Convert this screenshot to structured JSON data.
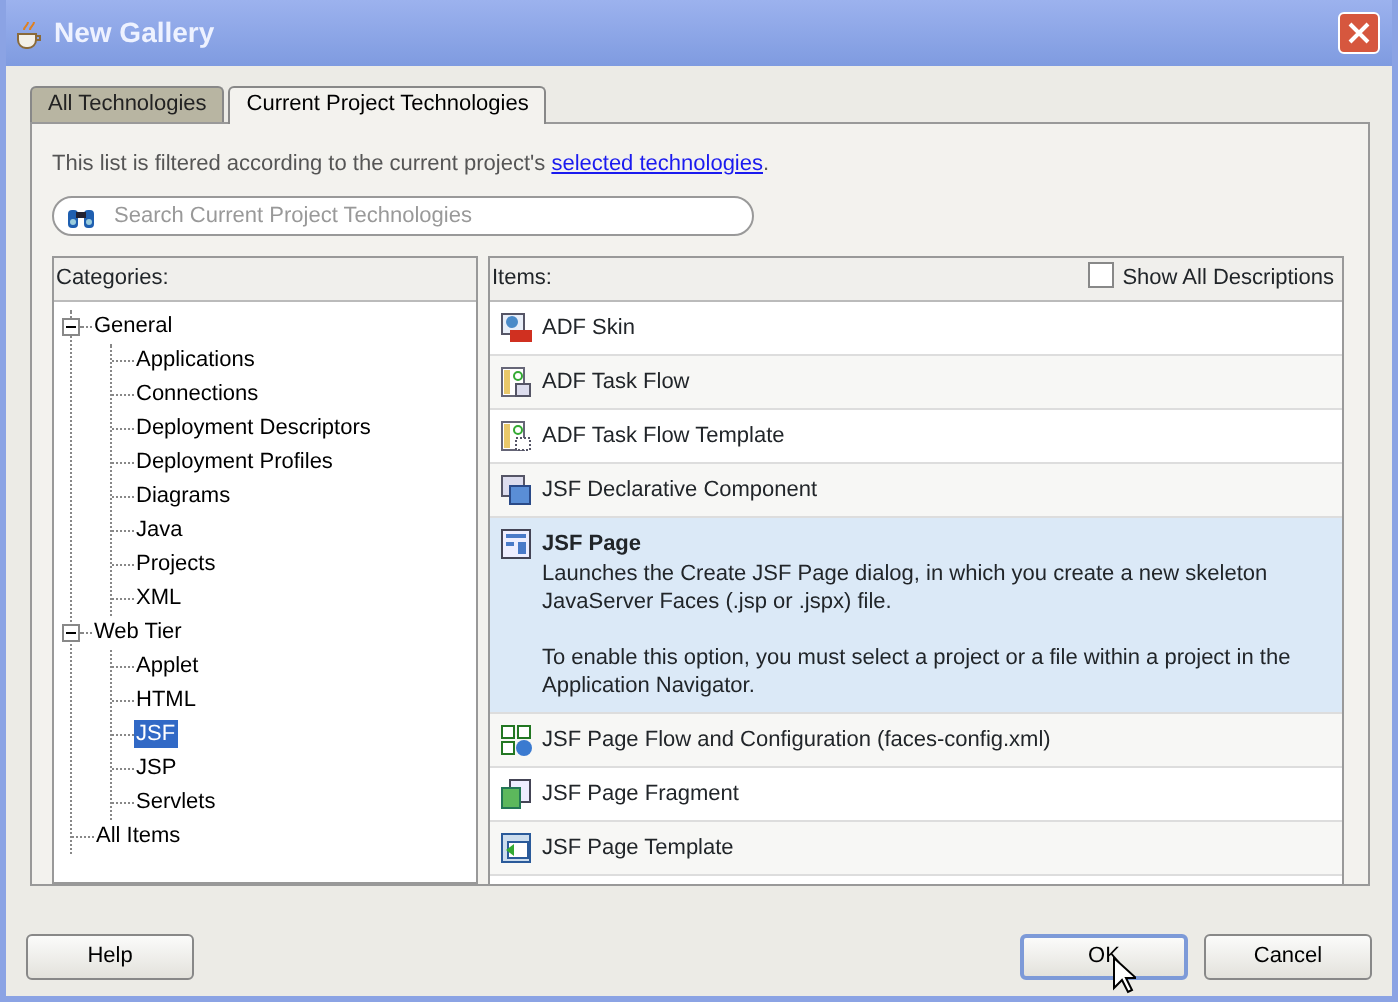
{
  "window": {
    "title": "New Gallery"
  },
  "tabs": [
    {
      "label": "All Technologies",
      "selected": false
    },
    {
      "label": "Current Project Technologies",
      "selected": true
    }
  ],
  "info": {
    "text": "This list is filtered according to the current project's ",
    "link": "selected technologies",
    "end": "."
  },
  "search": {
    "placeholder": "Search Current Project Technologies"
  },
  "categories": {
    "header": "Categories:",
    "tree": [
      {
        "label": "General",
        "expanded": true,
        "selected": false,
        "children": [
          {
            "label": "Applications",
            "selected": false
          },
          {
            "label": "Connections",
            "selected": false
          },
          {
            "label": "Deployment Descriptors",
            "selected": false
          },
          {
            "label": "Deployment Profiles",
            "selected": false
          },
          {
            "label": "Diagrams",
            "selected": false
          },
          {
            "label": "Java",
            "selected": false
          },
          {
            "label": "Projects",
            "selected": false
          },
          {
            "label": "XML",
            "selected": false
          }
        ]
      },
      {
        "label": "Web Tier",
        "expanded": true,
        "selected": false,
        "children": [
          {
            "label": "Applet",
            "selected": false
          },
          {
            "label": "HTML",
            "selected": false
          },
          {
            "label": "JSF",
            "selected": true
          },
          {
            "label": "JSP",
            "selected": false
          },
          {
            "label": "Servlets",
            "selected": false
          }
        ]
      },
      {
        "label": "All Items",
        "selected": false
      }
    ]
  },
  "items": {
    "header": "Items:",
    "show_all": {
      "label": "Show All Descriptions",
      "checked": false
    },
    "list": [
      {
        "label": "ADF Skin",
        "selected": false
      },
      {
        "label": "ADF Task Flow",
        "selected": false
      },
      {
        "label": "ADF Task Flow Template",
        "selected": false
      },
      {
        "label": "JSF Declarative Component",
        "selected": false
      },
      {
        "label": "JSF Page",
        "selected": true,
        "description": [
          "Launches the Create JSF Page dialog, in which you create a new skeleton JavaServer Faces (.jsp or .jspx) file.",
          "To enable this option, you must select a project or a file within a project in the Application Navigator."
        ]
      },
      {
        "label": "JSF Page Flow and Configuration (faces-config.xml)",
        "selected": false
      },
      {
        "label": "JSF Page Fragment",
        "selected": false
      },
      {
        "label": "JSF Page Template",
        "selected": false
      }
    ]
  },
  "buttons": [
    {
      "label": "Help",
      "default": false
    },
    {
      "label": "OK",
      "default": true
    },
    {
      "label": "Cancel",
      "default": false
    }
  ]
}
